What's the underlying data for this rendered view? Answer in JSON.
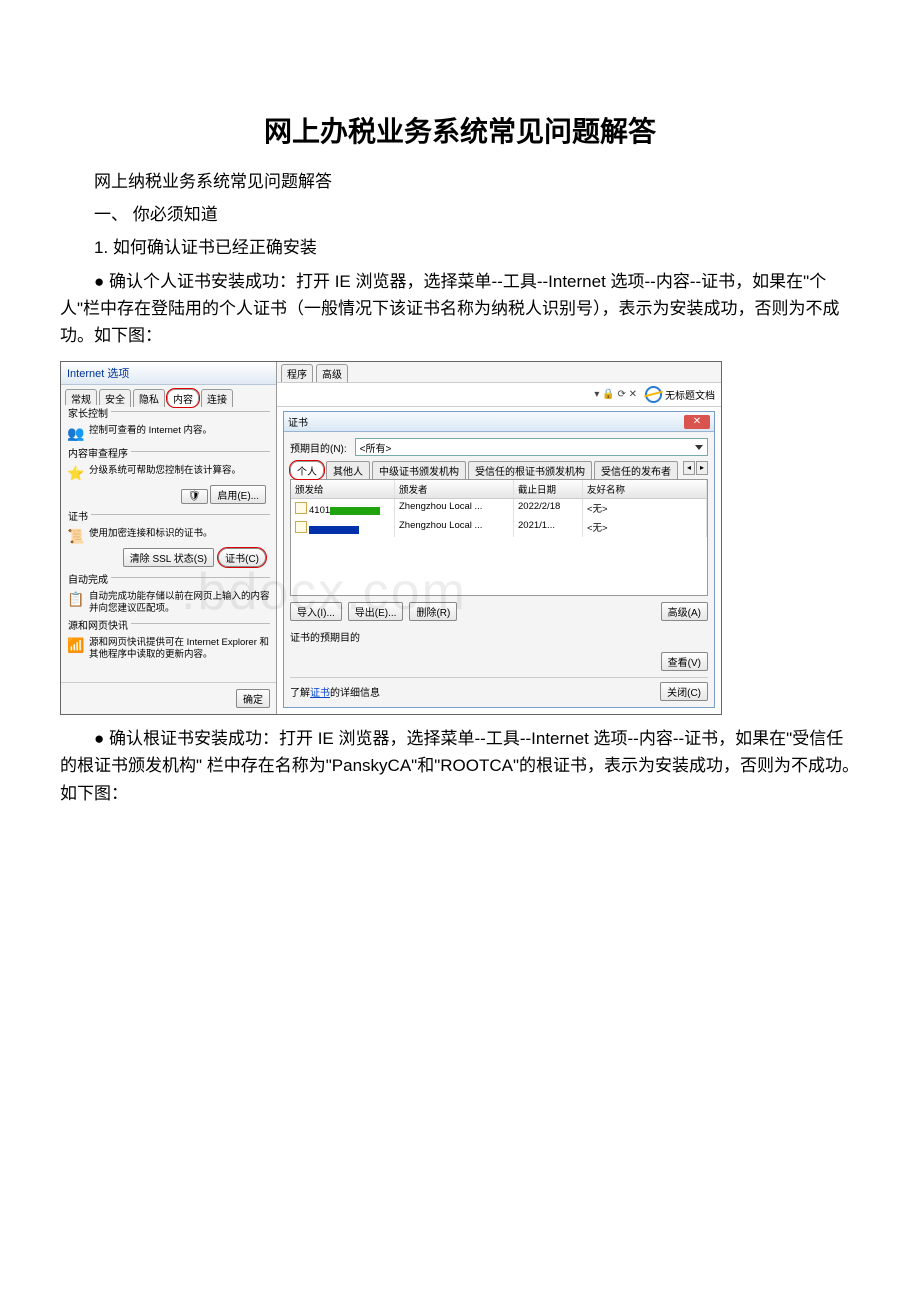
{
  "doc": {
    "title": "网上办税业务系统常见问题解答",
    "p1": "网上纳税业务系统常见问题解答",
    "p2": "一、 你必须知道",
    "p3": "1. 如何确认证书已经正确安装",
    "p4": "● 确认个人证书安装成功：打开 IE 浏览器，选择菜单--工具--Internet 选项--内容--证书，如果在\"个人\"栏中存在登陆用的个人证书（一般情况下该证书名称为纳税人识别号），表示为安装成功，否则为不成功。如下图：",
    "p5": "● 确认根证书安装成功：打开 IE 浏览器，选择菜单--工具--Internet 选项--内容--证书，如果在\"受信任的根证书颁发机构\" 栏中存在名称为\"PanskyCA\"和\"ROOTCA\"的根证书，表示为安装成功，否则为不成功。如下图："
  },
  "ie_options": {
    "window_title": "Internet 选项",
    "tabs": [
      "常规",
      "安全",
      "隐私",
      "内容",
      "连接",
      "程序",
      "高级"
    ],
    "groups": {
      "family": {
        "title": "家长控制",
        "text": "控制可查看的 Internet 内容。"
      },
      "rating": {
        "title": "内容审查程序",
        "text": "分级系统可帮助您控制在该计算容。",
        "btn": "启用(E)..."
      },
      "cert": {
        "title": "证书",
        "text": "使用加密连接和标识的证书。",
        "btn1": "清除 SSL 状态(S)",
        "btn2": "证书(C)"
      },
      "auto": {
        "title": "自动完成",
        "text": "自动完成功能存储以前在网页上输入的内容并向您建议匹配项。"
      },
      "feed": {
        "title": "源和网页快讯",
        "text": "源和网页快讯提供可在 Internet Explorer 和其他程序中读取的更新内容。"
      }
    },
    "ok": "确定"
  },
  "browser_bar": {
    "search_hint": "𝒫",
    "controls": "▾ 🔒 ⟳ ✕",
    "page_label": "无标题文档"
  },
  "cert_dlg": {
    "title": "证书",
    "purpose_label": "预期目的(N):",
    "purpose_value": "<所有>",
    "tabs": [
      "个人",
      "其他人",
      "中级证书颁发机构",
      "受信任的根证书颁发机构",
      "受信任的发布者"
    ],
    "columns": [
      "颁发给",
      "颁发者",
      "截止日期",
      "友好名称"
    ],
    "rows": [
      {
        "issued_to_prefix": "4101",
        "issuer": "Zhengzhou Local ...",
        "expires": "2022/2/18",
        "friendly": "<无>"
      },
      {
        "issued_to_prefix": "",
        "issuer": "Zhengzhou Local ...",
        "expires": "2021/1...",
        "friendly": "<无>"
      }
    ],
    "btn_import": "导入(I)...",
    "btn_export": "导出(E)...",
    "btn_remove": "删除(R)",
    "btn_advanced": "高级(A)",
    "section_label": "证书的预期目的",
    "btn_view": "查看(V)",
    "learn_prefix": "了解",
    "learn_link": "证书",
    "learn_suffix": "的详细信息",
    "btn_close": "关闭(C)"
  },
  "watermark": ".bdocx.com"
}
